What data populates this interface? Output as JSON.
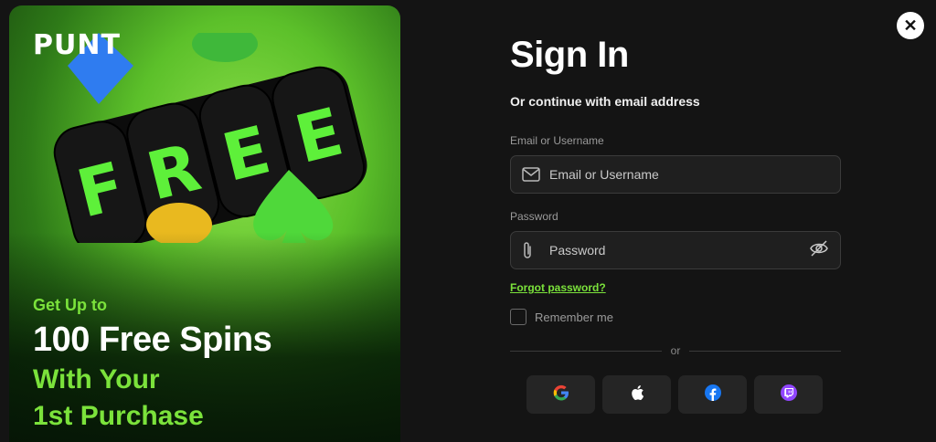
{
  "promo": {
    "logo": "PUNT",
    "reel_text": [
      "F",
      "R",
      "E",
      "E"
    ],
    "line1": "Get Up to",
    "line2": "100 Free Spins",
    "line3": "With Your",
    "line4": "1st Purchase"
  },
  "close_label": "✕",
  "form": {
    "title": "Sign In",
    "subtitle": "Or continue with email address",
    "email_label": "Email or Username",
    "email_placeholder": "Email or Username",
    "password_label": "Password",
    "password_placeholder": "Password",
    "forgot_password": "Forgot password?",
    "remember_me": "Remember me",
    "divider_text": "or"
  },
  "socials": [
    {
      "name": "google",
      "icon": "google-icon"
    },
    {
      "name": "apple",
      "icon": "apple-icon"
    },
    {
      "name": "facebook",
      "icon": "facebook-icon"
    },
    {
      "name": "twitch",
      "icon": "twitch-icon"
    }
  ],
  "colors": {
    "accent": "#7be23b",
    "background": "#141414",
    "input_bg": "#1f1f1f",
    "facebook": "#1877f2",
    "twitch": "#9146ff"
  }
}
